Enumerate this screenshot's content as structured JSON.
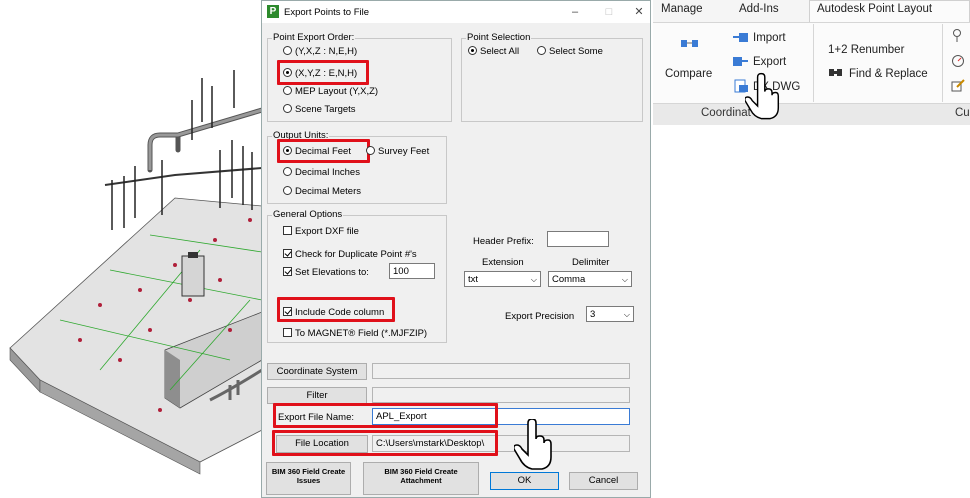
{
  "dialog": {
    "title": "Export Points to File",
    "minimize": "–",
    "maximize": "□",
    "close": "✕",
    "point_export_order": {
      "label": "Point Export Order:",
      "options": [
        "(Y,X,Z : N,E,H)",
        "(X,Y,Z : E,N,H)",
        "MEP Layout (Y,X,Z)",
        "Scene Targets"
      ],
      "selected": 1
    },
    "point_selection": {
      "label": "Point Selection",
      "options": [
        "Select All",
        "Select Some"
      ],
      "selected": 0
    },
    "output_units": {
      "label": "Output Units:",
      "options": [
        "Decimal Feet",
        "Survey Feet",
        "Decimal Inches",
        "Decimal Meters"
      ],
      "selected": 0
    },
    "general_options": {
      "label": "General Options",
      "export_dxf": {
        "label": "Export DXF file",
        "checked": false
      },
      "check_duplicates": {
        "label": "Check for Duplicate Point #'s",
        "checked": true
      },
      "set_elevations": {
        "label": "Set Elevations to:",
        "checked": true,
        "value": "100"
      },
      "include_code": {
        "label": "Include Code column",
        "checked": true
      },
      "to_magnet": {
        "label": "To MAGNET® Field (*.MJFZIP)",
        "checked": false
      }
    },
    "header_prefix": {
      "label": "Header Prefix:",
      "value": ""
    },
    "extension": {
      "label": "Extension",
      "value": "txt"
    },
    "delimiter": {
      "label": "Delimiter",
      "value": "Comma"
    },
    "export_precision": {
      "label": "Export Precision",
      "value": "3"
    },
    "coordinate_system_button": "Coordinate System",
    "filter_button": "Filter",
    "export_file_name": {
      "label": "Export File Name:",
      "value": "APL_Export"
    },
    "file_location": {
      "label": "File Location",
      "value": "C:\\Users\\mstark\\Desktop\\"
    },
    "bim360_issues": "BIM 360 Field Create Issues",
    "bim360_attachment": "BIM 360 Field Create Attachment",
    "ok": "OK",
    "cancel": "Cancel"
  },
  "ribbon": {
    "tabs": [
      "Manage",
      "Add-Ins",
      "Autodesk Point Layout"
    ],
    "active_tab": 2,
    "compare": "Compare",
    "import": "Import",
    "export": "Export",
    "dx_dwg": "DX DWG",
    "renumber": "1+2 Renumber",
    "find_replace": "Find & Replace",
    "panel_label": "Coordinat",
    "panel_label_2": "Cu"
  },
  "colors": {
    "highlight": "#e0101a",
    "accent_green": "#2c8a2c"
  }
}
